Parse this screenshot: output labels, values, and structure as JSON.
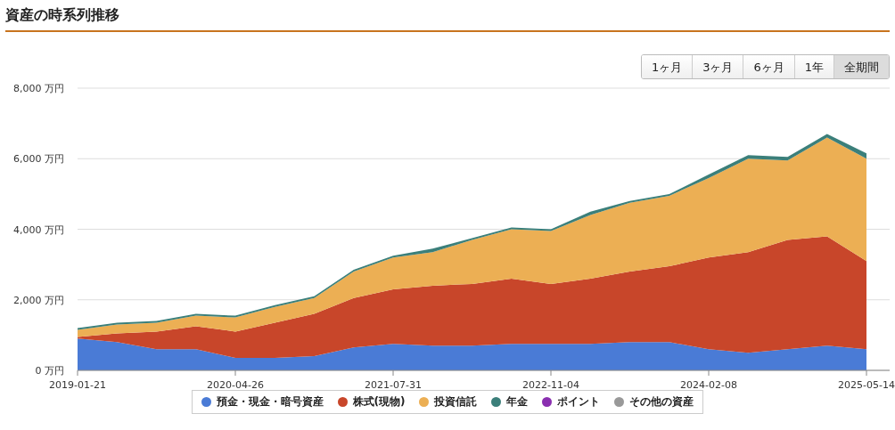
{
  "title": "資産の時系列推移",
  "range_buttons": [
    {
      "label": "1ヶ月",
      "selected": false
    },
    {
      "label": "3ヶ月",
      "selected": false
    },
    {
      "label": "6ヶ月",
      "selected": false
    },
    {
      "label": "1年",
      "selected": false
    },
    {
      "label": "全期間",
      "selected": true
    }
  ],
  "chart_data": {
    "type": "area",
    "stacked": true,
    "grid": true,
    "categories": [
      "2019-01-21",
      null,
      null,
      null,
      "2020-04-26",
      null,
      null,
      null,
      "2021-07-31",
      null,
      null,
      null,
      "2022-11-04",
      null,
      null,
      null,
      "2024-02-08",
      null,
      null,
      null,
      "2025-05-14"
    ],
    "ylim": [
      0,
      8000
    ],
    "yticks": [
      {
        "value": 0,
        "label": "0 万円"
      },
      {
        "value": 2000,
        "label": "2,000 万円"
      },
      {
        "value": 4000,
        "label": "4,000 万円"
      },
      {
        "value": 6000,
        "label": "6,000 万円"
      },
      {
        "value": 8000,
        "label": "8,000 万円"
      }
    ],
    "series": [
      {
        "name": "預金・現金・暗号資産",
        "color": "#4a7bd6",
        "values": [
          900,
          800,
          600,
          600,
          350,
          350,
          400,
          650,
          750,
          700,
          700,
          750,
          750,
          750,
          800,
          800,
          600,
          500,
          600,
          700,
          600
        ]
      },
      {
        "name": "株式(現物)",
        "color": "#c8462a",
        "values": [
          50,
          250,
          500,
          650,
          750,
          1000,
          1200,
          1400,
          1550,
          1700,
          1750,
          1850,
          1700,
          1850,
          2000,
          2150,
          2600,
          2850,
          3100,
          3100,
          2500
        ]
      },
      {
        "name": "投資信託",
        "color": "#ecaf54",
        "values": [
          200,
          250,
          250,
          300,
          400,
          450,
          450,
          750,
          900,
          950,
          1250,
          1400,
          1500,
          1800,
          1950,
          2000,
          2250,
          2650,
          2250,
          2800,
          2900
        ]
      },
      {
        "name": "年金",
        "color": "#3b7f7a",
        "values": [
          50,
          50,
          50,
          50,
          50,
          50,
          50,
          50,
          50,
          100,
          50,
          50,
          50,
          100,
          50,
          50,
          100,
          100,
          100,
          100,
          150
        ]
      },
      {
        "name": "ポイント",
        "color": "#8a2fb0",
        "values": [
          null,
          null,
          null,
          null,
          null,
          null,
          null,
          null,
          null,
          null,
          null,
          null,
          null,
          null,
          null,
          null,
          null,
          null,
          null,
          null,
          null
        ]
      },
      {
        "name": "その他の資産",
        "color": "#999999",
        "values": [
          null,
          null,
          null,
          null,
          null,
          null,
          null,
          null,
          null,
          null,
          null,
          null,
          null,
          null,
          null,
          null,
          null,
          null,
          null,
          null,
          null
        ]
      }
    ]
  }
}
